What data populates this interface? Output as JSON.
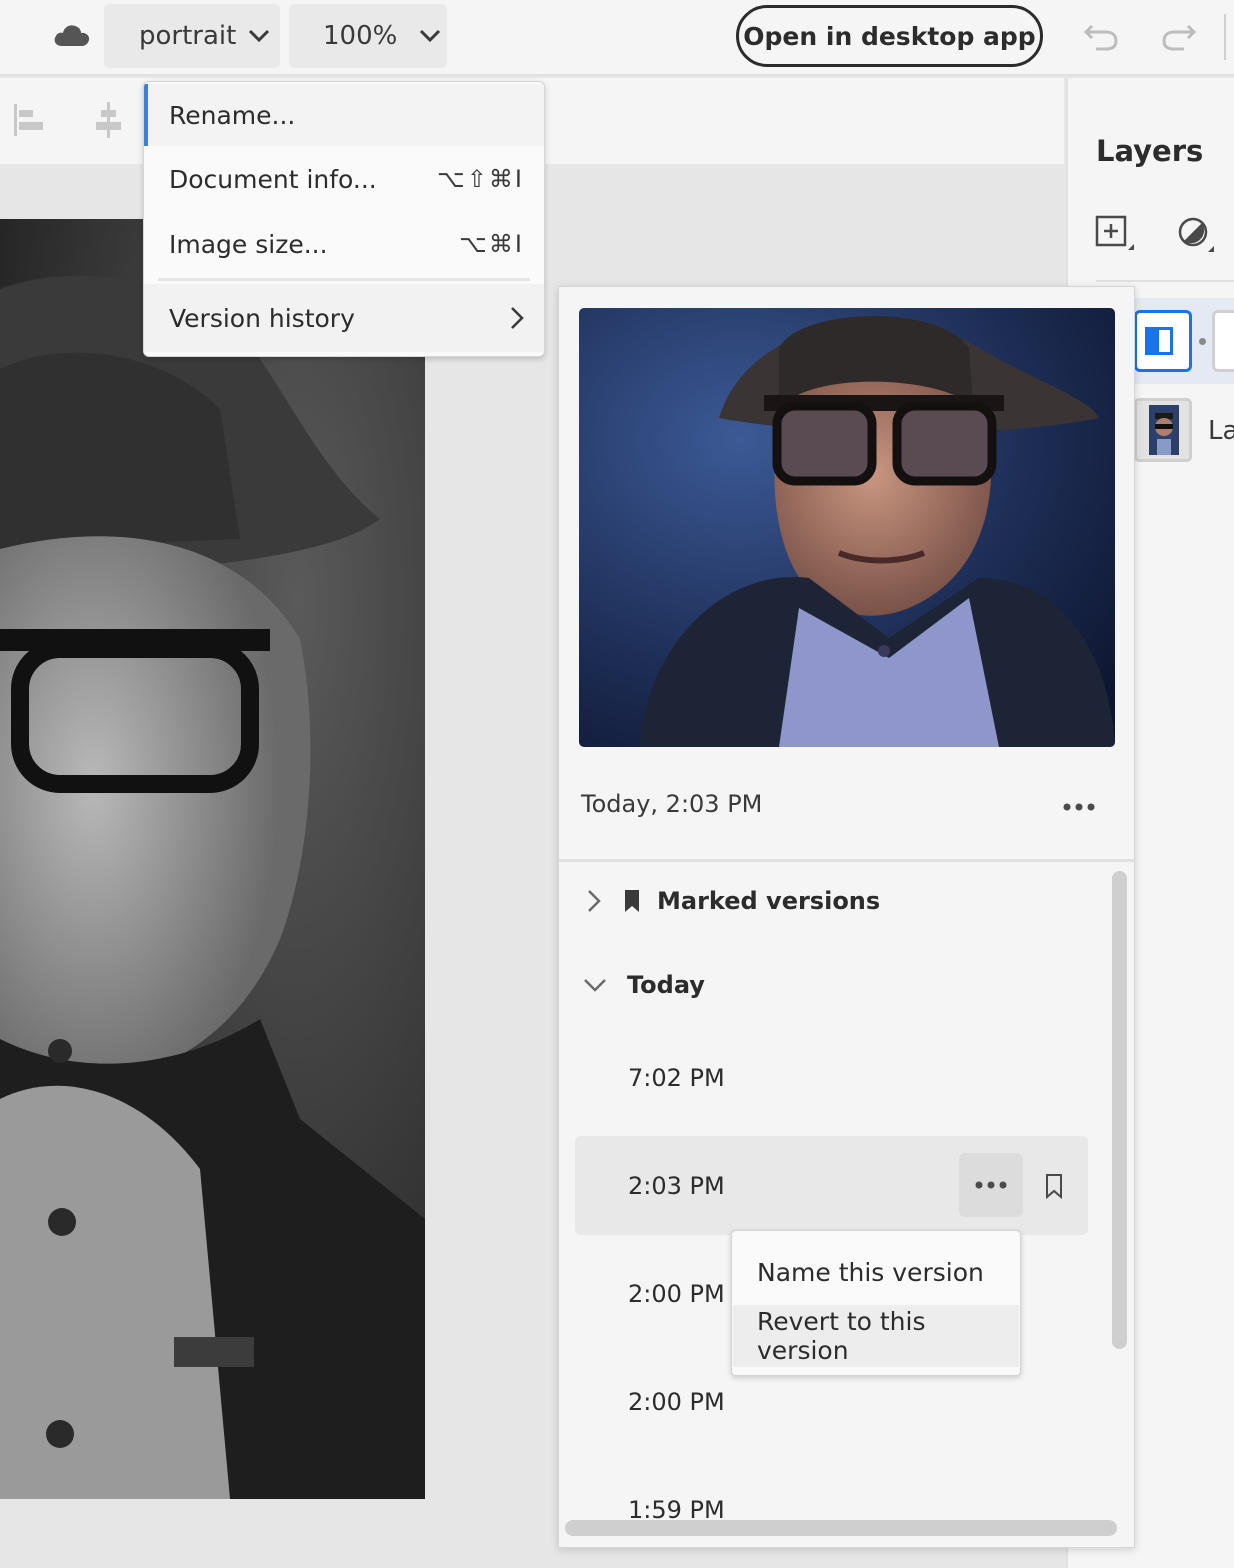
{
  "topbar": {
    "doc_name": "portrait",
    "zoom": "100%",
    "open_desktop_label": "Open in desktop app"
  },
  "file_menu": {
    "items": [
      {
        "label": "Rename...",
        "shortcut": ""
      },
      {
        "label": "Document info...",
        "shortcut": "⌥⇧⌘I"
      },
      {
        "label": "Image size...",
        "shortcut": "⌥⌘I"
      },
      {
        "label": "Version history",
        "shortcut": ""
      }
    ]
  },
  "layers_panel": {
    "title": "Layers",
    "layer_label": "La"
  },
  "version_history": {
    "preview_time": "Today, 2:03 PM",
    "marked_versions_label": "Marked versions",
    "today_label": "Today",
    "versions": [
      "7:02 PM",
      "2:03 PM",
      "2:00 PM",
      "2:00 PM",
      "1:59 PM"
    ]
  },
  "context_menu": {
    "items": [
      "Name this version",
      "Revert to this version"
    ]
  },
  "icons": {
    "cloud": "cloud-icon",
    "undo": "undo-icon",
    "redo": "redo-icon",
    "bookmark": "bookmark-icon",
    "more": "more-icon"
  },
  "colors": {
    "accent": "#1a73e8",
    "menu_focus_bar": "#3a80d8"
  }
}
